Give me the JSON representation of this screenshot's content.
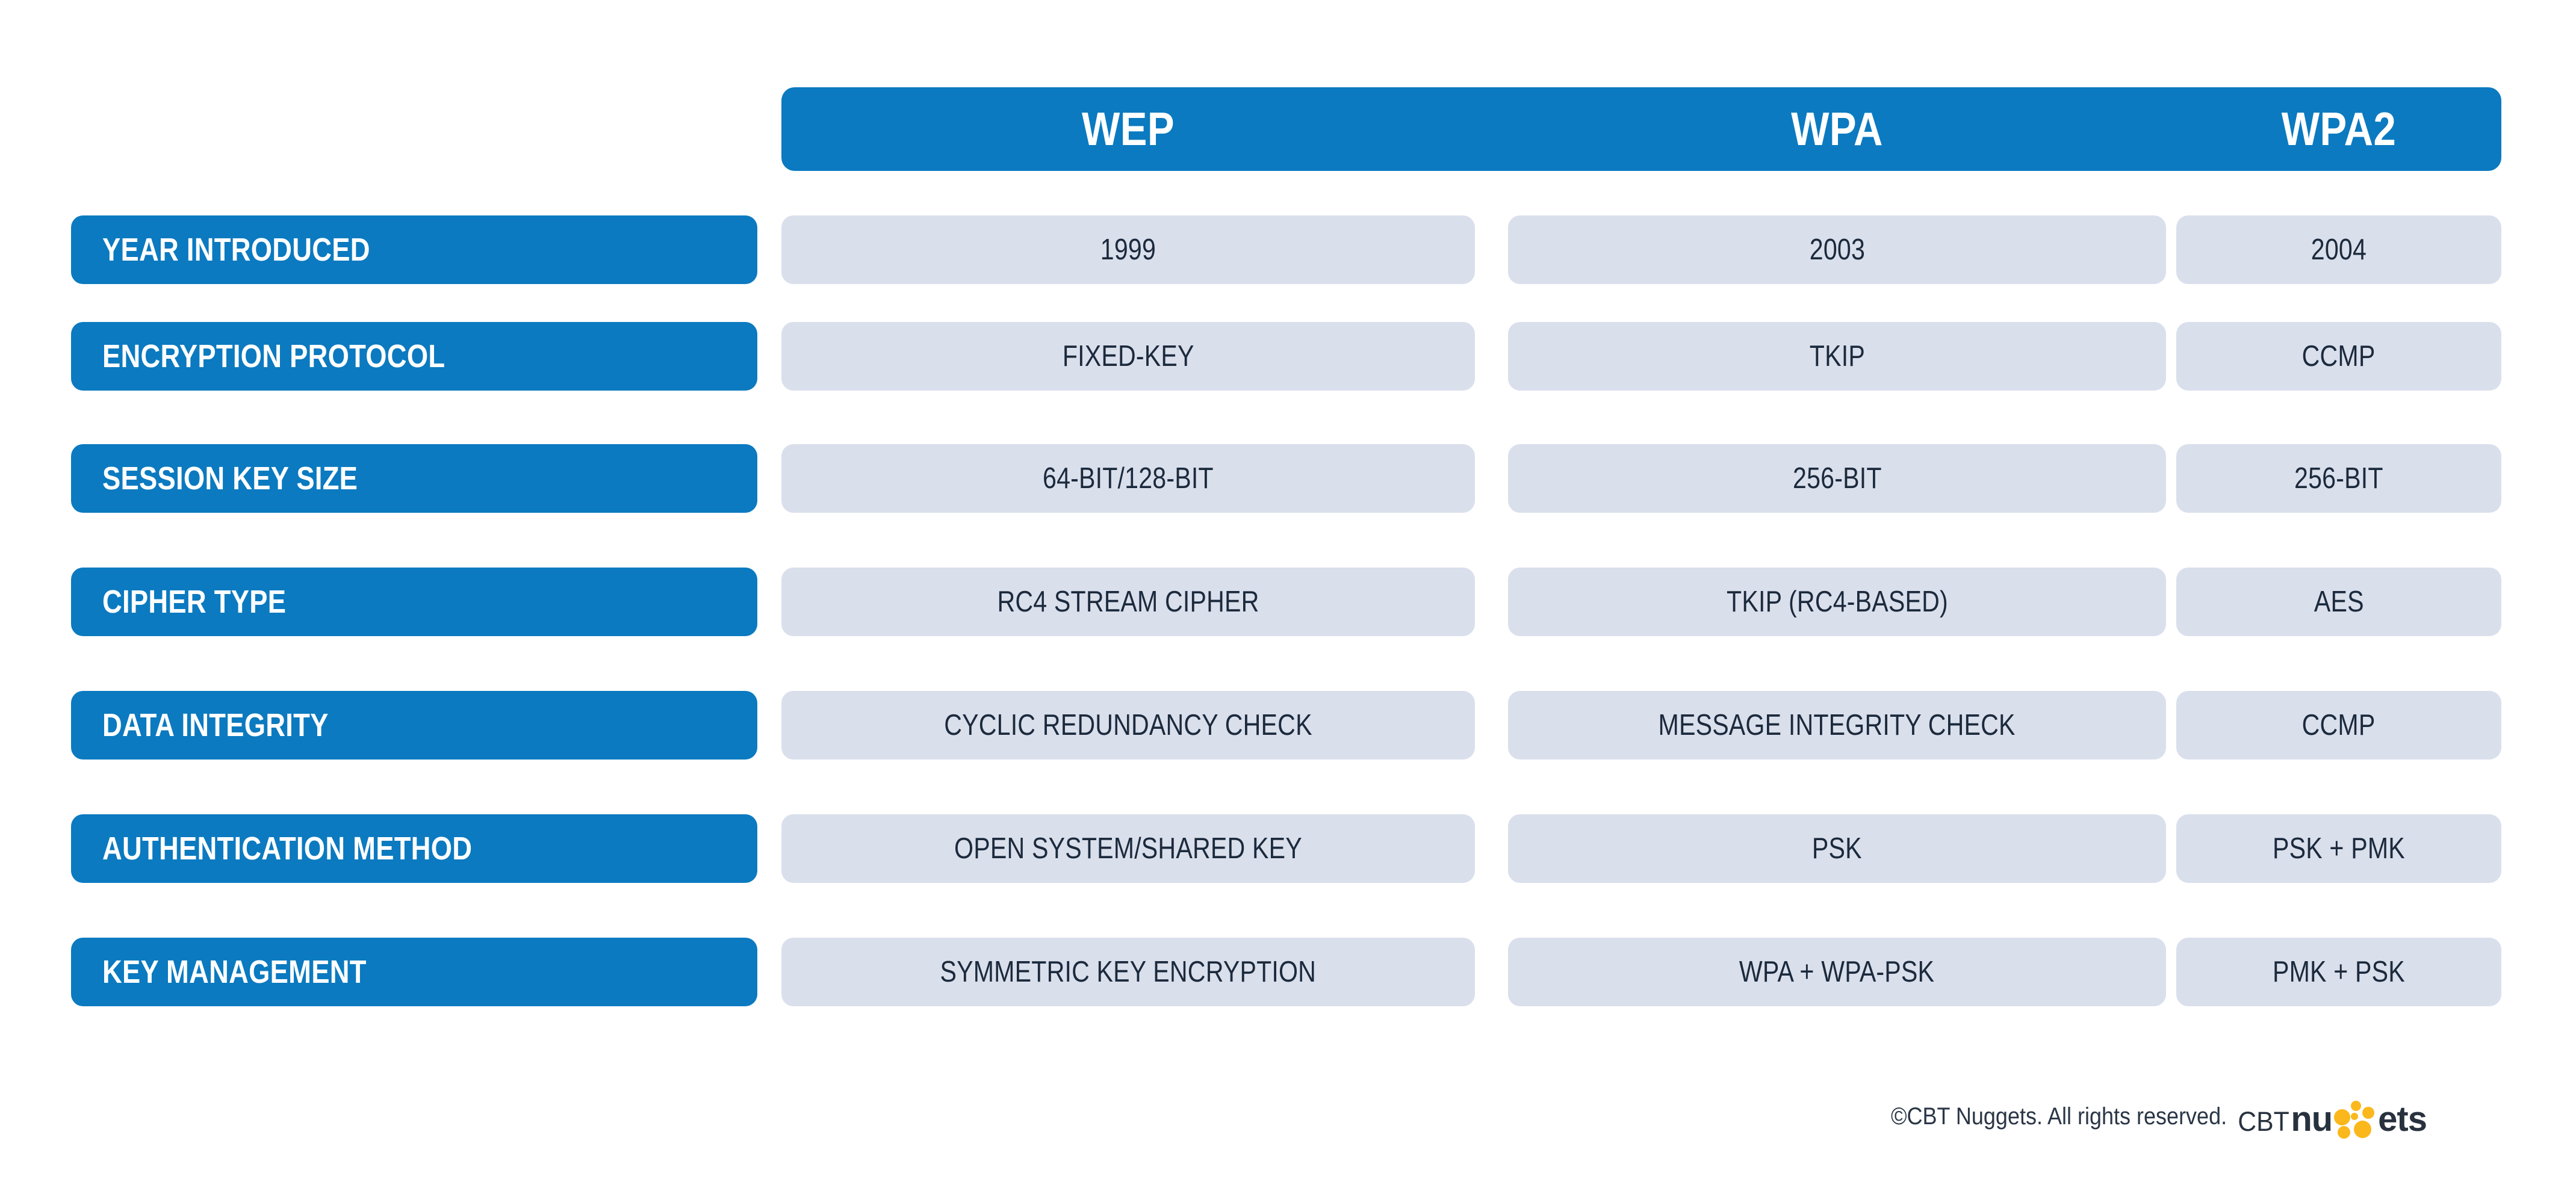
{
  "colors": {
    "brand_blue": "#0B7AC0",
    "cell_bg": "#DADFEC",
    "text_dark": "#1B2A3C",
    "logo_accent": "#FBB81C",
    "page_bg": "#FFFFFF"
  },
  "header": {
    "corner_label": "",
    "columns": [
      {
        "key": "wep",
        "label": "WEP"
      },
      {
        "key": "wpa",
        "label": "WPA"
      },
      {
        "key": "wpa2",
        "label": "WPA2"
      }
    ]
  },
  "rows": [
    {
      "label": "YEAR INTRODUCED",
      "wep": "1999",
      "wpa": "2003",
      "wpa2": "2004"
    },
    {
      "label": "ENCRYPTION PROTOCOL",
      "wep": "FIXED-KEY",
      "wpa": "TKIP",
      "wpa2": "CCMP"
    },
    {
      "label": "SESSION KEY SIZE",
      "wep": "64-BIT/128-BIT",
      "wpa": "256-BIT",
      "wpa2": "256-BIT"
    },
    {
      "label": "CIPHER TYPE",
      "wep": "RC4 STREAM CIPHER",
      "wpa": "TKIP (RC4-BASED)",
      "wpa2": "AES"
    },
    {
      "label": "DATA INTEGRITY",
      "wep": "CYCLIC REDUNDANCY CHECK",
      "wpa": "MESSAGE INTEGRITY CHECK",
      "wpa2": "CCMP"
    },
    {
      "label": "AUTHENTICATION METHOD",
      "wep": "OPEN SYSTEM/SHARED KEY",
      "wpa": "PSK",
      "wpa2": "PSK + PMK"
    },
    {
      "label": "KEY MANAGEMENT",
      "wep": "SYMMETRIC KEY ENCRYPTION",
      "wpa": "WPA + WPA-PSK",
      "wpa2": "PMK + PSK"
    }
  ],
  "footer": {
    "copyright": "©CBT Nuggets. All rights reserved.",
    "logo": {
      "prefix": "CBT",
      "part_one": "nu",
      "part_two": "ets",
      "dots_icon": "nugget-dots-icon"
    }
  }
}
